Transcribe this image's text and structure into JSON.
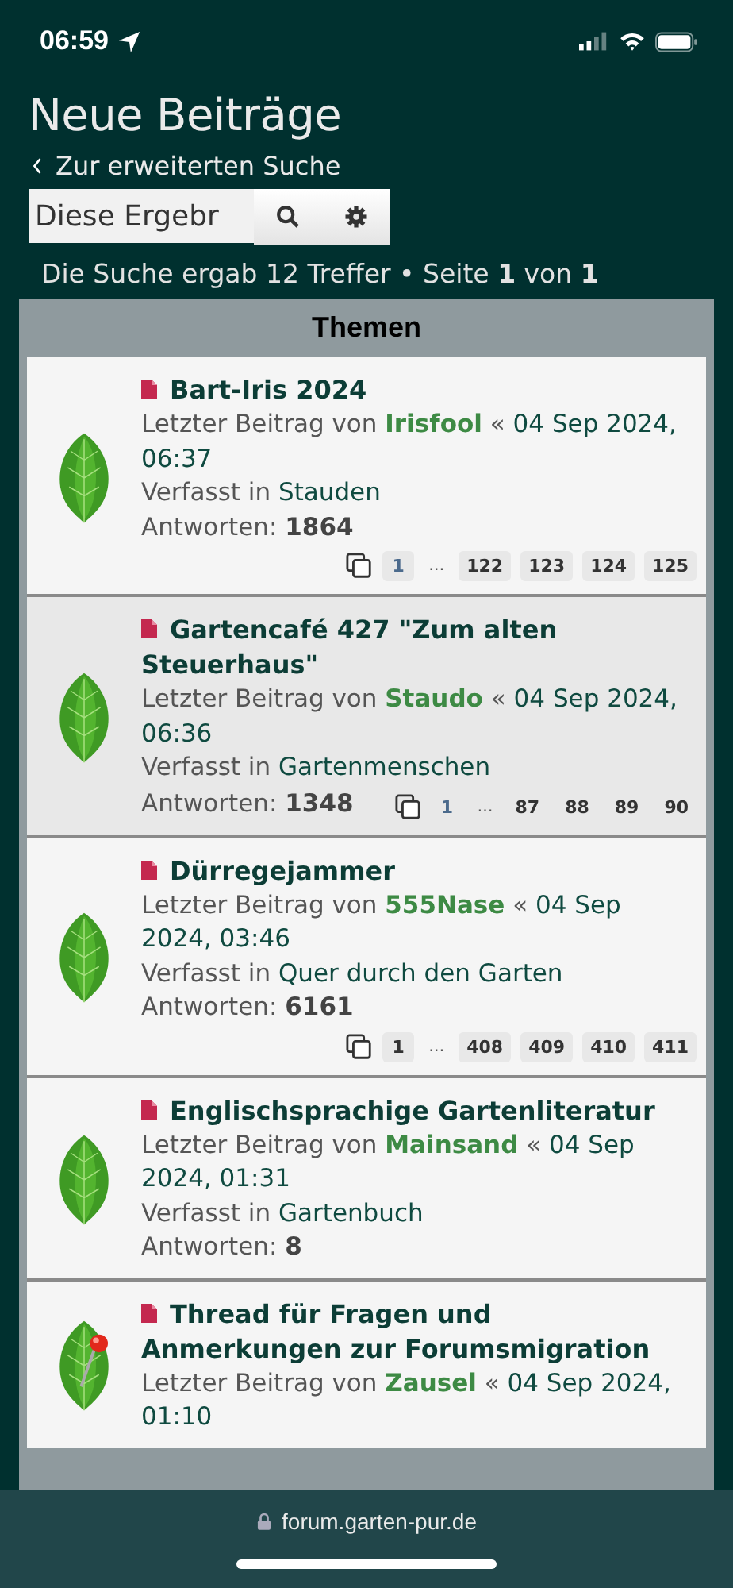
{
  "status_bar": {
    "time": "06:59"
  },
  "page_title": "Neue Beiträge",
  "back_link": "Zur erweiterten Suche",
  "search": {
    "value": "Diese Ergebr"
  },
  "results": "Die Suche ergab 12 Treffer • Seite **1** von **1**",
  "table": {
    "header": "Themen",
    "topics": [
      {
        "title": "Bart-Iris 2024",
        "pinned": false,
        "highlighted": false,
        "last_post_label": "Letzter Beitrag von",
        "author": "Irisfool",
        "date_separator": "«",
        "date": "04 Sep 2024, 06:37",
        "forum_label": "Verfasst in",
        "forum": "Stauden",
        "replies": "Antworten: **1864**",
        "pages": [
          {
            "kind": "page",
            "label": "1",
            "visited": true
          },
          {
            "kind": "ellipsis",
            "label": "…"
          },
          {
            "kind": "page",
            "label": "122",
            "visited": false
          },
          {
            "kind": "page",
            "label": "123",
            "visited": false
          },
          {
            "kind": "page",
            "label": "124",
            "visited": false
          },
          {
            "kind": "page",
            "label": "125",
            "visited": false
          }
        ]
      },
      {
        "title": "Gartencafé 427 \"Zum alten Steuerhaus\"",
        "pinned": false,
        "highlighted": true,
        "last_post_label": "Letzter Beitrag von",
        "author": "Staudo",
        "date_separator": "«",
        "date": "04 Sep 2024, 06:36",
        "forum_label": "Verfasst in",
        "forum": "Gartenmenschen",
        "replies": "Antworten: **1348**",
        "pages": [
          {
            "kind": "page",
            "label": "1",
            "visited": true
          },
          {
            "kind": "ellipsis",
            "label": "…"
          },
          {
            "kind": "page",
            "label": "87",
            "visited": false
          },
          {
            "kind": "page",
            "label": "88",
            "visited": false
          },
          {
            "kind": "page",
            "label": "89",
            "visited": false
          },
          {
            "kind": "page",
            "label": "90",
            "visited": false
          }
        ]
      },
      {
        "title": "Dürregejammer",
        "pinned": false,
        "highlighted": false,
        "last_post_label": "Letzter Beitrag von",
        "author": "555Nase",
        "date_separator": "«",
        "date": "04 Sep 2024, 03:46",
        "forum_label": "Verfasst in",
        "forum": "Quer durch den Garten",
        "replies": "Antworten: **6161**",
        "pages": [
          {
            "kind": "page",
            "label": "1",
            "visited": false
          },
          {
            "kind": "ellipsis",
            "label": "…"
          },
          {
            "kind": "page",
            "label": "408",
            "visited": false
          },
          {
            "kind": "page",
            "label": "409",
            "visited": false
          },
          {
            "kind": "page",
            "label": "410",
            "visited": false
          },
          {
            "kind": "page",
            "label": "411",
            "visited": false
          }
        ]
      },
      {
        "title": "Englischsprachige Gartenliteratur",
        "pinned": false,
        "highlighted": false,
        "last_post_label": "Letzter Beitrag von",
        "author": "Mainsand",
        "date_separator": "«",
        "date": "04 Sep 2024, 01:31",
        "forum_label": "Verfasst in",
        "forum": "Gartenbuch",
        "replies": "Antworten: **8**"
      },
      {
        "title": "Thread für Fragen und Anmerkungen zur Forumsmigration",
        "pinned": true,
        "highlighted": false,
        "last_post_label": "Letzter Beitrag von",
        "author": "Zausel",
        "date_separator": "«",
        "date": "04 Sep 2024, 01:10"
      }
    ]
  },
  "browser_bar": {
    "url": "forum.garten-pur.de"
  }
}
